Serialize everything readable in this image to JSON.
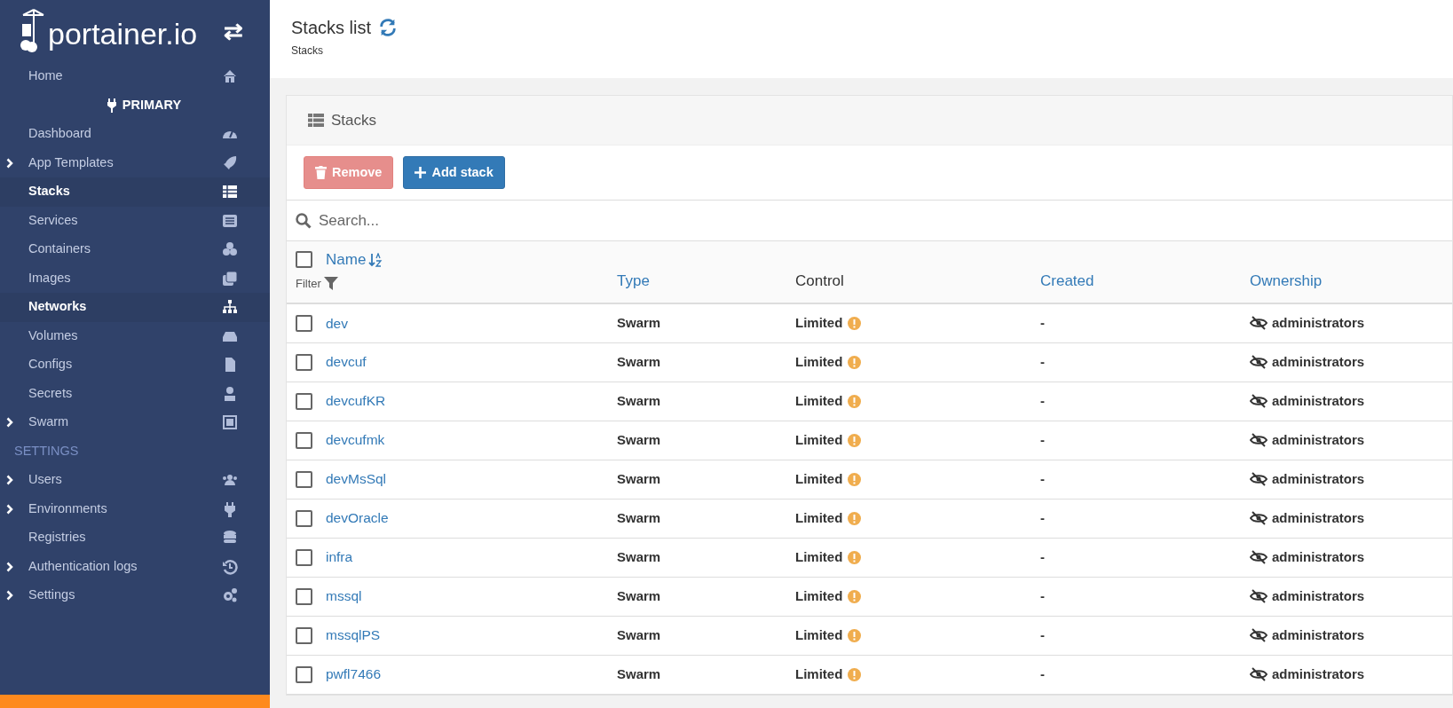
{
  "sidebar": {
    "logo_text": "portainer.io",
    "toggle_icon": "⇄",
    "items": [
      {
        "kind": "link",
        "label": "Home",
        "expandable": false,
        "selected": false
      },
      {
        "kind": "environment",
        "label": "PRIMARY"
      },
      {
        "kind": "link",
        "label": "Dashboard",
        "expandable": false,
        "selected": false
      },
      {
        "kind": "link",
        "label": "App Templates",
        "expandable": true,
        "selected": false
      },
      {
        "kind": "link",
        "label": "Stacks",
        "expandable": false,
        "selected": true
      },
      {
        "kind": "link",
        "label": "Services",
        "expandable": false,
        "selected": false
      },
      {
        "kind": "link",
        "label": "Containers",
        "expandable": false,
        "selected": false
      },
      {
        "kind": "link",
        "label": "Images",
        "expandable": false,
        "selected": false
      },
      {
        "kind": "link",
        "label": "Networks",
        "expandable": false,
        "selected": true
      },
      {
        "kind": "link",
        "label": "Volumes",
        "expandable": false,
        "selected": false
      },
      {
        "kind": "link",
        "label": "Configs",
        "expandable": false,
        "selected": false
      },
      {
        "kind": "link",
        "label": "Secrets",
        "expandable": false,
        "selected": false
      },
      {
        "kind": "link",
        "label": "Swarm",
        "expandable": true,
        "selected": false
      },
      {
        "kind": "heading",
        "label": "SETTINGS"
      },
      {
        "kind": "link",
        "label": "Users",
        "expandable": true,
        "selected": false
      },
      {
        "kind": "link",
        "label": "Environments",
        "expandable": true,
        "selected": false
      },
      {
        "kind": "link",
        "label": "Registries",
        "expandable": false,
        "selected": false
      },
      {
        "kind": "link",
        "label": "Authentication logs",
        "expandable": true,
        "selected": false
      },
      {
        "kind": "link",
        "label": "Settings",
        "expandable": true,
        "selected": false
      }
    ]
  },
  "header": {
    "title": "Stacks list",
    "breadcrumb": "Stacks"
  },
  "panel": {
    "title": "Stacks",
    "buttons": [
      {
        "kind": "danger",
        "label": "Remove",
        "disabled": true
      },
      {
        "kind": "primary",
        "label": "Add stack",
        "disabled": false
      }
    ],
    "search": {
      "placeholder": "Search..."
    },
    "table": {
      "select_all_checked": false,
      "columns": [
        {
          "label": "Name",
          "sortable": true,
          "filter": "Filter"
        },
        {
          "label": "Type",
          "sortable": true
        },
        {
          "label": "Control",
          "sortable": false
        },
        {
          "label": "Created",
          "sortable": true
        },
        {
          "label": "Ownership",
          "sortable": true
        }
      ],
      "rows": [
        {
          "checked": false,
          "name": "dev",
          "type": "Swarm",
          "control": "Limited",
          "created": "-",
          "ownership": "administrators"
        },
        {
          "checked": false,
          "name": "devcuf",
          "type": "Swarm",
          "control": "Limited",
          "created": "-",
          "ownership": "administrators"
        },
        {
          "checked": false,
          "name": "devcufKR",
          "type": "Swarm",
          "control": "Limited",
          "created": "-",
          "ownership": "administrators"
        },
        {
          "checked": false,
          "name": "devcufmk",
          "type": "Swarm",
          "control": "Limited",
          "created": "-",
          "ownership": "administrators"
        },
        {
          "checked": false,
          "name": "devMsSql",
          "type": "Swarm",
          "control": "Limited",
          "created": "-",
          "ownership": "administrators"
        },
        {
          "checked": false,
          "name": "devOracle",
          "type": "Swarm",
          "control": "Limited",
          "created": "-",
          "ownership": "administrators"
        },
        {
          "checked": false,
          "name": "infra",
          "type": "Swarm",
          "control": "Limited",
          "created": "-",
          "ownership": "administrators"
        },
        {
          "checked": false,
          "name": "mssql",
          "type": "Swarm",
          "control": "Limited",
          "created": "-",
          "ownership": "administrators"
        },
        {
          "checked": false,
          "name": "mssqlPS",
          "type": "Swarm",
          "control": "Limited",
          "created": "-",
          "ownership": "administrators"
        },
        {
          "checked": false,
          "name": "pwfl7466",
          "type": "Swarm",
          "control": "Limited",
          "created": "-",
          "ownership": "administrators"
        }
      ]
    }
  }
}
